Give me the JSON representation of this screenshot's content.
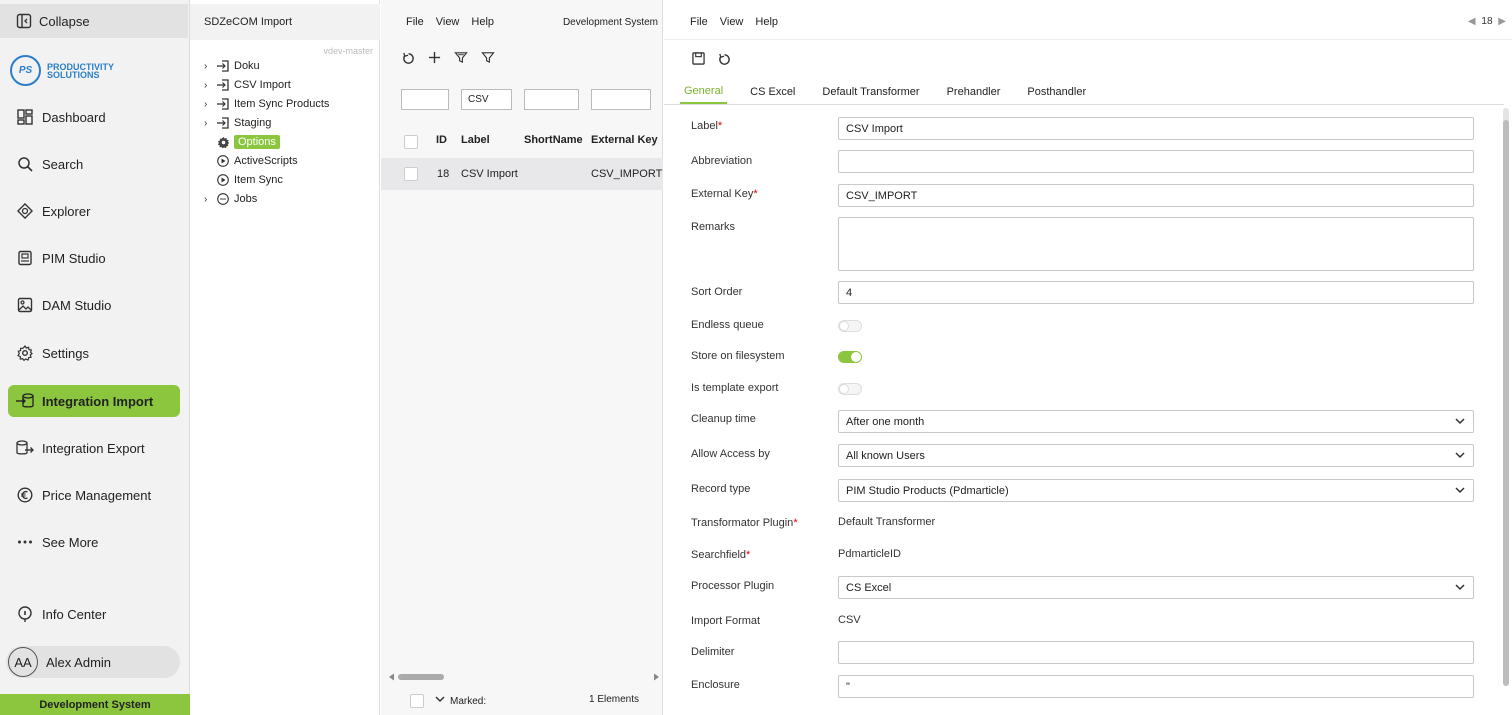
{
  "nav": {
    "collapse_label": "Collapse",
    "logo_mark": "PS",
    "logo_line1": "PRODUCTIVITY",
    "logo_line2": "SOLUTIONS",
    "items": [
      {
        "label": "Dashboard",
        "icon": "dashboard-icon"
      },
      {
        "label": "Search",
        "icon": "search-icon"
      },
      {
        "label": "Explorer",
        "icon": "explorer-icon"
      },
      {
        "label": "PIM Studio",
        "icon": "pim-icon"
      },
      {
        "label": "DAM Studio",
        "icon": "image-icon"
      },
      {
        "label": "Settings",
        "icon": "gear-icon"
      },
      {
        "label": "Integration Import",
        "icon": "import-icon",
        "active": true
      },
      {
        "label": "Integration Export",
        "icon": "export-icon"
      },
      {
        "label": "Price Management",
        "icon": "euro-icon"
      },
      {
        "label": "See More",
        "icon": "more-icon"
      },
      {
        "label": "Info Center",
        "icon": "info-icon"
      }
    ],
    "user_initials": "AA",
    "user_name": "Alex Admin",
    "system_label": "Development System",
    "accent_color": "#8cc63f"
  },
  "tree": {
    "title": "SDZeCOM Import",
    "branch": "vdev-master",
    "nodes": [
      {
        "label": "Doku",
        "expandable": true,
        "icon": "import-arrow-icon"
      },
      {
        "label": "CSV Import",
        "expandable": true,
        "icon": "import-arrow-icon"
      },
      {
        "label": "Item Sync Products",
        "expandable": true,
        "icon": "import-arrow-icon"
      },
      {
        "label": "Staging",
        "expandable": true,
        "icon": "import-arrow-icon"
      },
      {
        "label": "Options",
        "expandable": false,
        "icon": "gear-icon",
        "selected": true
      },
      {
        "label": "ActiveScripts",
        "expandable": false,
        "icon": "play-icon"
      },
      {
        "label": "Item Sync",
        "expandable": false,
        "icon": "play-icon"
      },
      {
        "label": "Jobs",
        "expandable": true,
        "icon": "jobs-icon"
      }
    ]
  },
  "list": {
    "menu": [
      "File",
      "View",
      "Help"
    ],
    "system_name": "Development System",
    "filter_label_value": "CSV",
    "columns": [
      "ID",
      "Label",
      "ShortName",
      "External Key"
    ],
    "rows": [
      {
        "id": "18",
        "label": "CSV Import",
        "shortname": "",
        "external_key": "CSV_IMPORT"
      }
    ],
    "marked_label": "Marked:",
    "elements_count": "1 Elements"
  },
  "detail": {
    "menu": [
      "File",
      "View",
      "Help"
    ],
    "pager_value": "18",
    "tabs": [
      "General",
      "CS Excel",
      "Default Transformer",
      "Prehandler",
      "Posthandler"
    ],
    "active_tab": "General",
    "fields": {
      "label": {
        "label": "Label",
        "value": "CSV Import"
      },
      "abbreviation": {
        "label": "Abbreviation",
        "value": ""
      },
      "external_key": {
        "label": "External Key",
        "value": "CSV_IMPORT"
      },
      "remarks": {
        "label": "Remarks",
        "value": ""
      },
      "sort_order": {
        "label": "Sort Order",
        "value": "4"
      },
      "endless_queue": {
        "label": "Endless queue",
        "on": false
      },
      "store_fs": {
        "label": "Store on filesystem",
        "on": true
      },
      "template_export": {
        "label": "Is template export",
        "on": false
      },
      "cleanup_time": {
        "label": "Cleanup time",
        "value": "After one month"
      },
      "allow_access": {
        "label": "Allow Access by",
        "value": "All known Users"
      },
      "record_type": {
        "label": "Record type",
        "value": "PIM Studio Products (Pdmarticle)"
      },
      "transformator": {
        "label": "Transformator Plugin",
        "value": "Default Transformer"
      },
      "searchfield": {
        "label": "Searchfield",
        "value": "PdmarticleID"
      },
      "processor": {
        "label": "Processor Plugin",
        "value": "CS Excel"
      },
      "import_format": {
        "label": "Import Format",
        "value": "CSV"
      },
      "delimiter": {
        "label": "Delimiter",
        "value": ""
      },
      "enclosure": {
        "label": "Enclosure",
        "value": "\""
      }
    },
    "required_mark": "*"
  }
}
